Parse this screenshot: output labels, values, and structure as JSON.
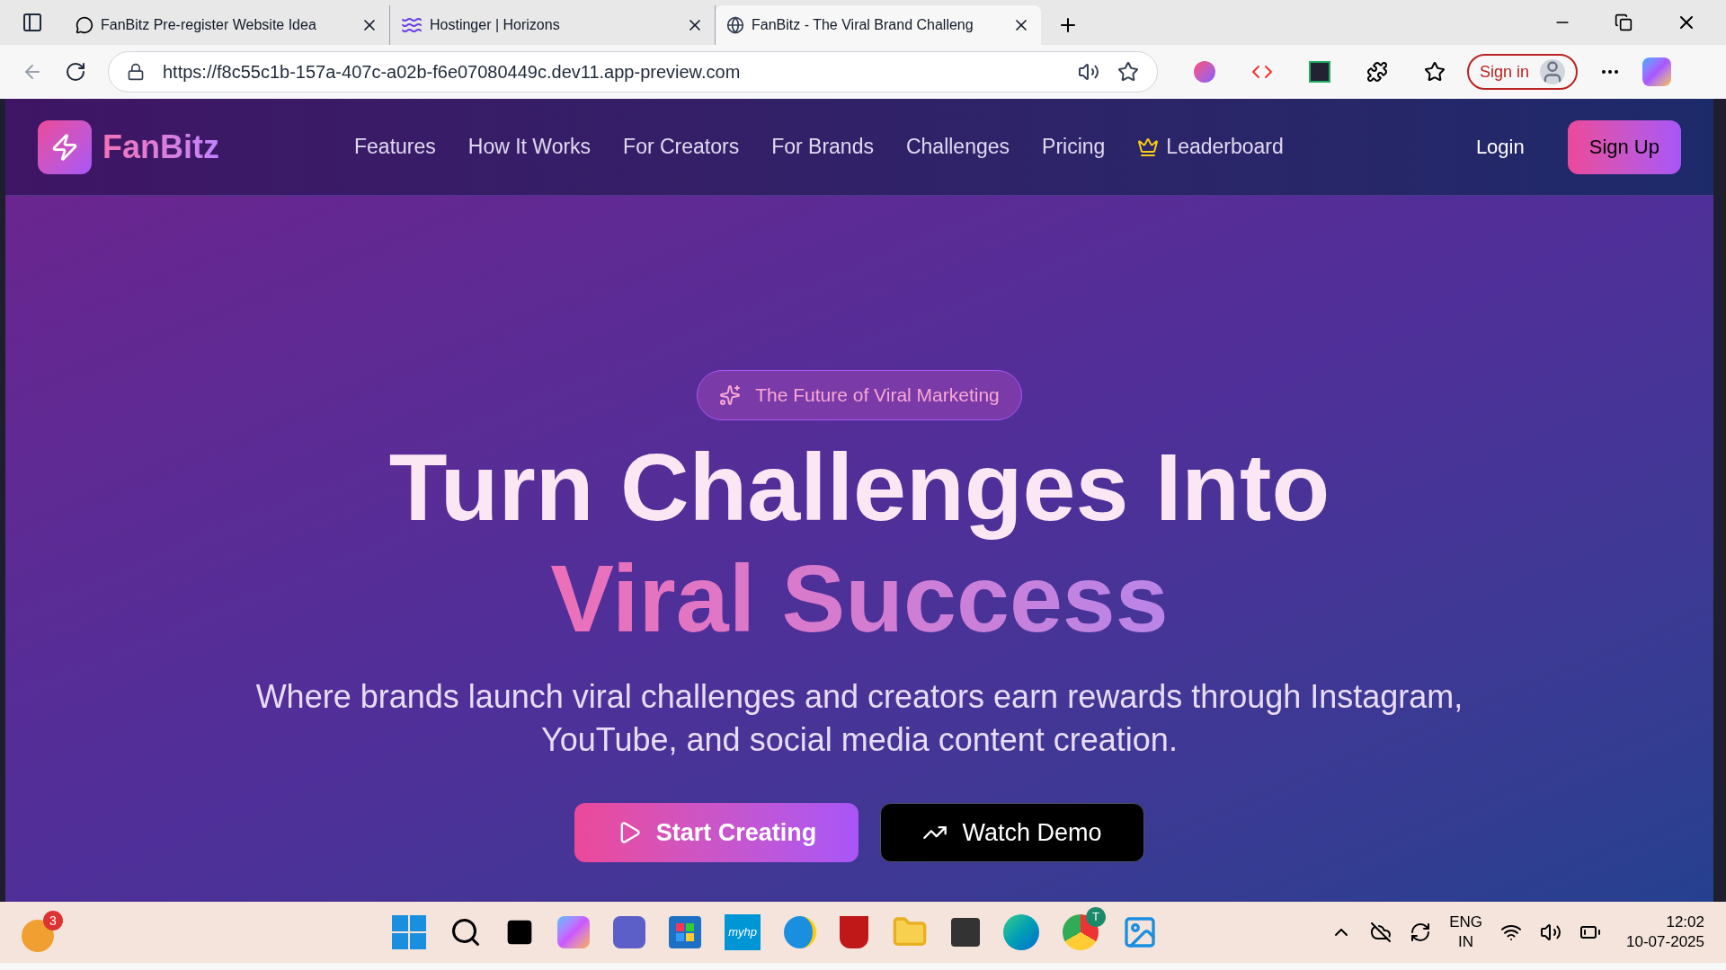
{
  "browser": {
    "tabs": [
      {
        "title": "FanBitz Pre-register Website Idea",
        "selected": false,
        "kind": "chat"
      },
      {
        "title": "Hostinger | Horizons",
        "selected": false,
        "kind": "waves"
      },
      {
        "title": "FanBitz - The Viral Brand Challeng",
        "selected": true,
        "kind": "globe"
      }
    ],
    "url": "https://f8c55c1b-157a-407c-a02b-f6e07080449c.dev11.app-preview.com",
    "sign_in": "Sign in"
  },
  "nav": {
    "logo": "FanBitz",
    "links": [
      {
        "label": "Features",
        "kind": "plain"
      },
      {
        "label": "How It Works",
        "kind": "plain"
      },
      {
        "label": "For Creators",
        "kind": "plain"
      },
      {
        "label": "For Brands",
        "kind": "plain"
      },
      {
        "label": "Challenges",
        "kind": "plain"
      },
      {
        "label": "Pricing",
        "kind": "plain"
      },
      {
        "label": "Leaderboard",
        "kind": "crown"
      }
    ],
    "login": "Login",
    "signup": "Sign Up"
  },
  "hero": {
    "badge": "The Future of Viral Marketing",
    "title_line_1": "Turn Challenges Into",
    "title_line_2": "Viral Success",
    "subtitle": "Where brands launch viral challenges and creators earn rewards through Instagram, YouTube, and social media content creation.",
    "primary_button": "Start Creating",
    "secondary_button": "Watch Demo"
  },
  "taskbar": {
    "weather_badge": "3",
    "myhp": "myhp",
    "chrome_badge": "T",
    "language": "ENG",
    "region": "IN",
    "time": "12:02",
    "date": "10-07-2025"
  }
}
